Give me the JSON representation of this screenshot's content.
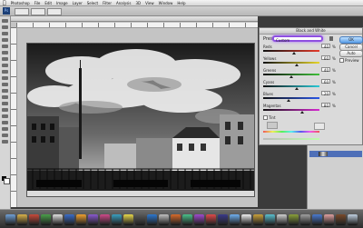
{
  "menubar": {
    "items": [
      "Photoshop",
      "File",
      "Edit",
      "Image",
      "Layer",
      "Select",
      "Filter",
      "Analysis",
      "3D",
      "View",
      "Window",
      "Help"
    ],
    "clock": ""
  },
  "document": {
    "tab_title": ""
  },
  "dialog": {
    "title": "Black and White",
    "preset_label": "Preset:",
    "preset_value": "Custom",
    "ok_label": "OK",
    "cancel_label": "Cancel",
    "auto_label": "Auto",
    "preview_label": "Preview",
    "tint_label": "Tint",
    "channels": [
      {
        "name": "Reds",
        "value": "40",
        "unit": "%",
        "color": "#e53a2a",
        "level": 0.55
      },
      {
        "name": "Yellows",
        "value": "60",
        "unit": "%",
        "color": "#e6d52a",
        "level": 0.6
      },
      {
        "name": "Greens",
        "value": "40",
        "unit": "%",
        "color": "#3fbf3a",
        "level": 0.5
      },
      {
        "name": "Cyans",
        "value": "60",
        "unit": "%",
        "color": "#2ac9d6",
        "level": 0.6
      },
      {
        "name": "Blues",
        "value": "20",
        "unit": "%",
        "color": "#2a56e6",
        "level": 0.45
      },
      {
        "name": "Magentas",
        "value": "80",
        "unit": "%",
        "color": "#d62ad0",
        "level": 0.7
      }
    ]
  },
  "colors": {
    "accent_highlight": "#8e4fe0",
    "dock_icons": [
      "#6fa0d8",
      "#d9b24a",
      "#c94a3a",
      "#4aa04a",
      "#e0e0e0",
      "#3a6cc9",
      "#f0a030",
      "#8a5ad0",
      "#d04a8a",
      "#3aa0c0",
      "#e8d84a",
      "#5a5a5a",
      "#2c78d0",
      "#c0c0c0",
      "#d86a2a",
      "#4ac08a",
      "#a04ad0",
      "#e04a4a",
      "#3a3a8a",
      "#70b0f0",
      "#f0f0f0",
      "#c9a03a",
      "#5ac0d0",
      "#d0d0d0",
      "#8aa03a",
      "#a0a0a0",
      "#4a7ad0",
      "#e0a0a0",
      "#7a4a2a",
      "#c0d0e0"
    ]
  }
}
